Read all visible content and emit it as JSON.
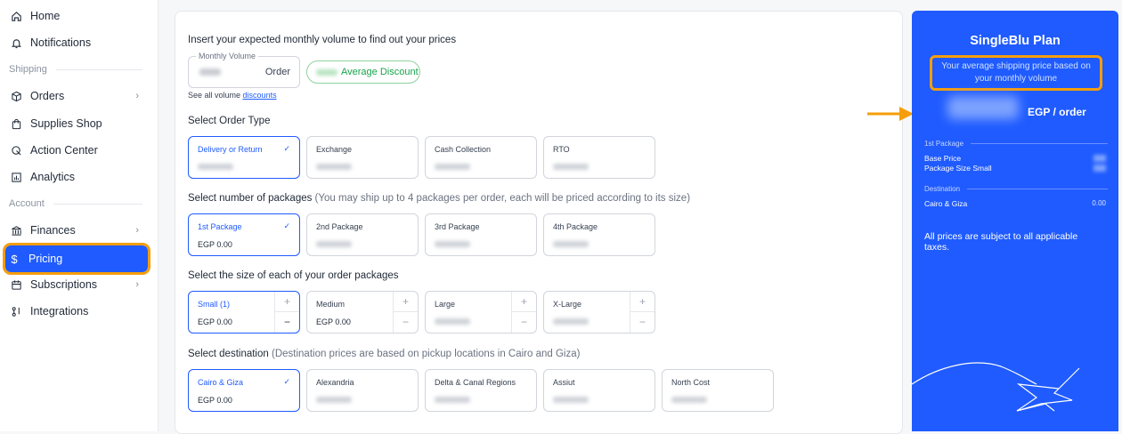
{
  "sidebar": {
    "items": [
      {
        "label": "Home",
        "icon": "home-icon"
      },
      {
        "label": "Notifications",
        "icon": "bell-icon"
      },
      {
        "label": "Orders",
        "icon": "box-icon"
      },
      {
        "label": "Supplies Shop",
        "icon": "bag-icon"
      },
      {
        "label": "Action Center",
        "icon": "action-icon"
      },
      {
        "label": "Analytics",
        "icon": "chart-icon"
      },
      {
        "label": "Finances",
        "icon": "bank-icon"
      },
      {
        "label": "Pricing",
        "icon": "dollar-icon"
      },
      {
        "label": "Subscriptions",
        "icon": "calendar-icon"
      },
      {
        "label": "Integrations",
        "icon": "integrations-icon"
      }
    ],
    "section_shipping": "Shipping",
    "section_account": "Account"
  },
  "main": {
    "volume_prompt": "Insert your expected monthly volume to find out your prices",
    "volume_legend": "Monthly Volume",
    "volume_unit": "Order",
    "discount_label": "Average Discount",
    "see_all": "See all volume ",
    "discounts_link": "discounts",
    "order_type_heading": "Select Order Type",
    "order_types": [
      "Delivery or Return",
      "Exchange",
      "Cash Collection",
      "RTO"
    ],
    "packages_heading": "Select number of packages",
    "packages_note": " (You may ship up to 4 packages per order, each will be priced according to its size)",
    "packages": [
      "1st Package",
      "2nd Package",
      "3rd Package",
      "4th Package"
    ],
    "first_package_price": "EGP 0.00",
    "sizes_heading": "Select the size of each of your order packages",
    "sizes": [
      "Small (1)",
      "Medium",
      "Large",
      "X-Large"
    ],
    "size_prices": [
      "EGP 0.00",
      "EGP 0.00"
    ],
    "destination_heading": "Select destination",
    "destination_note": " (Destination prices are based on pickup locations in Cairo and Giza)",
    "destinations": [
      "Cairo & Giza",
      "Alexandria",
      "Delta & Canal Regions",
      "Assiut",
      "North Cost"
    ],
    "destination_price": "EGP 0.00"
  },
  "panel": {
    "title": "SingleBlu Plan",
    "note": "Your average shipping price based on your monthly volume",
    "price_unit": "EGP / order",
    "section_package": "1st Package",
    "base_price": "Base Price",
    "package_size": "Package Size Small",
    "section_destination": "Destination",
    "destination": "Cairo & Giza",
    "destination_value": "0.00",
    "taxes": "All prices are subject to all applicable taxes."
  },
  "colors": {
    "accent": "#1f5bff",
    "highlight": "#f59e0b",
    "success": "#16a34a"
  }
}
